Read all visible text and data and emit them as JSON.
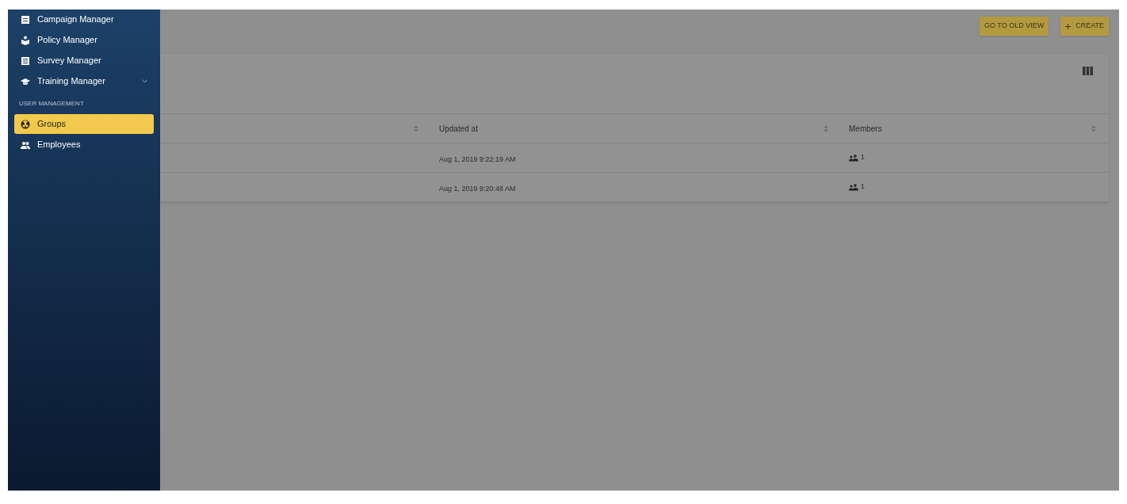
{
  "sidebar": {
    "items": [
      {
        "kind": "item",
        "label": "Campaign Manager",
        "selected": false
      },
      {
        "kind": "item",
        "label": "Policy Manager",
        "selected": false
      },
      {
        "kind": "item",
        "label": "Survey Manager",
        "selected": false
      },
      {
        "kind": "item",
        "label": "Training Manager",
        "selected": false,
        "expanded": false
      },
      {
        "kind": "section",
        "label": "USER MANAGEMENT"
      },
      {
        "kind": "item",
        "label": "Groups",
        "selected": true
      },
      {
        "kind": "item",
        "label": "Employees",
        "selected": false
      }
    ]
  },
  "toolbar": {
    "buttons": [
      {
        "label": "GO TO OLD VIEW"
      },
      {
        "label": "CREATE"
      }
    ]
  },
  "table": {
    "columns": [
      "Updated at",
      "Members"
    ],
    "rows": [
      {
        "updated_at": "Aug 1, 2019 9:22:19 AM",
        "members": "1"
      },
      {
        "updated_at": "Aug 1, 2019 9:20:48 AM",
        "members": "1"
      }
    ]
  }
}
